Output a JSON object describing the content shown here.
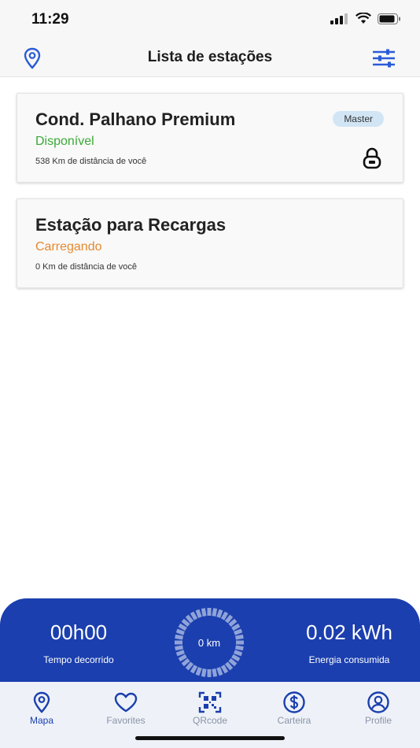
{
  "status_bar": {
    "time": "11:29"
  },
  "header": {
    "title": "Lista de estações",
    "left_icon": "map-pin-icon",
    "right_icon": "filter-icon"
  },
  "stations": [
    {
      "name": "Cond. Palhano Premium",
      "status": "Disponível",
      "status_color": "#3aa935",
      "distance": "538 Km de distância de você",
      "badge": "Master",
      "lock_icon": "lock-icon"
    },
    {
      "name": "Estação para Recargas",
      "status": "Carregando",
      "status_color": "#e5892f",
      "distance": "0 Km de distância de você"
    }
  ],
  "session": {
    "time_value": "00h00",
    "time_label": "Tempo decorrido",
    "distance_value": "0 km",
    "energy_value": "0.02 kWh",
    "energy_label": "Energia consumida"
  },
  "nav": {
    "items": [
      {
        "label": "Mapa",
        "icon": "map-pin-icon",
        "active": true
      },
      {
        "label": "Favorites",
        "icon": "heart-icon"
      },
      {
        "label": "QRcode",
        "icon": "qrcode-icon"
      },
      {
        "label": "Carteira",
        "icon": "dollar-icon"
      },
      {
        "label": "Profile",
        "icon": "profile-icon"
      }
    ]
  },
  "colors": {
    "accent": "#2a5bd7",
    "panel": "#1b3fae",
    "nav_active": "#1b3fae",
    "nav_inactive": "#8a93a8"
  }
}
